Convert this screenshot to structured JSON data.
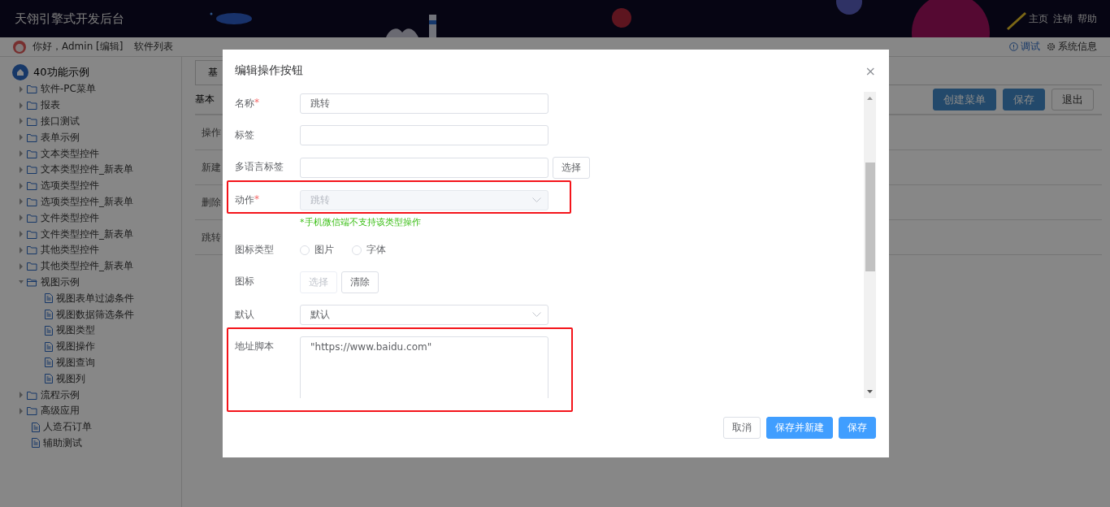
{
  "header": {
    "title": "天翎引擎式开发后台",
    "links": [
      "主页",
      "注销",
      "帮助"
    ]
  },
  "subbar": {
    "greeting": "你好，Admin [编辑]",
    "software_list": "软件列表",
    "debug": "调试",
    "system_info": "系统信息"
  },
  "sidebar": {
    "root": "40功能示例",
    "items": [
      {
        "kind": "folder",
        "label": "软件-PC菜单",
        "expanded": false
      },
      {
        "kind": "folder",
        "label": "报表",
        "expanded": false
      },
      {
        "kind": "folder",
        "label": "接口测试",
        "expanded": false
      },
      {
        "kind": "folder",
        "label": "表单示例",
        "expanded": false
      },
      {
        "kind": "folder",
        "label": "文本类型控件",
        "expanded": false
      },
      {
        "kind": "folder",
        "label": "文本类型控件_新表单",
        "expanded": false
      },
      {
        "kind": "folder",
        "label": "选项类型控件",
        "expanded": false
      },
      {
        "kind": "folder",
        "label": "选项类型控件_新表单",
        "expanded": false
      },
      {
        "kind": "folder",
        "label": "文件类型控件",
        "expanded": false
      },
      {
        "kind": "folder",
        "label": "文件类型控件_新表单",
        "expanded": false
      },
      {
        "kind": "folder",
        "label": "其他类型控件",
        "expanded": false
      },
      {
        "kind": "folder",
        "label": "其他类型控件_新表单",
        "expanded": false
      },
      {
        "kind": "folder",
        "label": "视图示例",
        "expanded": true,
        "children": [
          {
            "kind": "file",
            "label": "视图表单过滤条件"
          },
          {
            "kind": "file",
            "label": "视图数据筛选条件"
          },
          {
            "kind": "file",
            "label": "视图类型"
          },
          {
            "kind": "file",
            "label": "视图操作"
          },
          {
            "kind": "file",
            "label": "视图查询"
          },
          {
            "kind": "file",
            "label": "视图列"
          }
        ]
      },
      {
        "kind": "folder",
        "label": "流程示例",
        "expanded": false
      },
      {
        "kind": "folder",
        "label": "高级应用",
        "expanded": false
      },
      {
        "kind": "file",
        "label": "人造石订单"
      },
      {
        "kind": "file",
        "label": "辅助测试"
      }
    ]
  },
  "main": {
    "tab": "基",
    "section": "基本",
    "buttons": [
      {
        "label": "创建菜单",
        "primary": true
      },
      {
        "label": "保存",
        "primary": true
      },
      {
        "label": "退出",
        "primary": false
      }
    ],
    "rows": [
      "操作",
      "新建",
      "删除",
      "跳转"
    ]
  },
  "dialog": {
    "title": "编辑操作按钮",
    "close": "×",
    "required_mark": "*",
    "fields": [
      {
        "kind": "text",
        "label": "名称",
        "required": true,
        "value": "跳转"
      },
      {
        "kind": "text",
        "label": "标签",
        "required": false
      },
      {
        "kind": "text",
        "label": "多语言标签",
        "required": false,
        "button": "选择"
      },
      {
        "kind": "select",
        "label": "动作",
        "required": true,
        "value": "跳转",
        "disabled": true,
        "highlighted": true,
        "hint": "*手机微信端不支持该类型操作"
      },
      {
        "kind": "radio",
        "label": "图标类型",
        "required": false,
        "options": [
          {
            "label": "图片",
            "selected": false
          },
          {
            "label": "字体",
            "selected": false
          }
        ]
      },
      {
        "kind": "buttons",
        "label": "图标",
        "required": false,
        "buttons": [
          {
            "label": "选择",
            "disabled": true
          },
          {
            "label": "清除",
            "disabled": false
          }
        ]
      },
      {
        "kind": "select",
        "label": "默认",
        "required": false,
        "value": "默认",
        "disabled": false
      },
      {
        "kind": "textarea",
        "label": "地址脚本",
        "required": false,
        "value": "\"https://www.baidu.com\"",
        "highlighted": true
      }
    ],
    "buttons": [
      {
        "label": "取消",
        "primary": false
      },
      {
        "label": "保存并新建",
        "primary": true
      },
      {
        "label": "保存",
        "primary": true
      }
    ]
  }
}
